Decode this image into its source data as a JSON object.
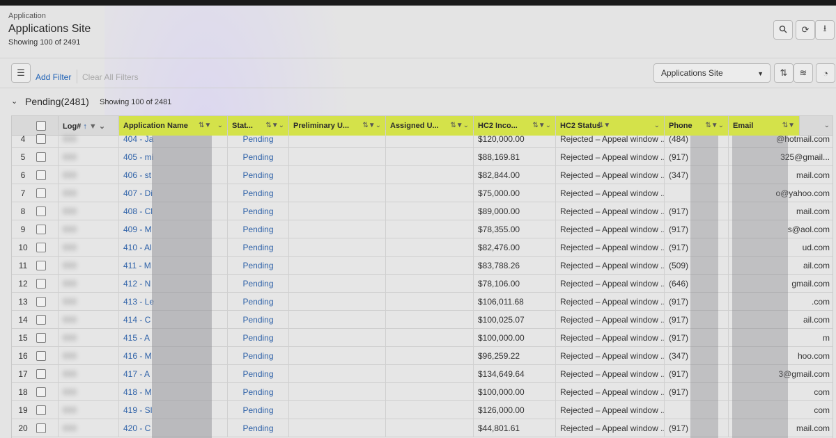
{
  "header": {
    "breadcrumb": "Application",
    "title": "Applications Site",
    "count_text": "Showing 100 of 2491",
    "buttons": [
      "search-icon",
      "refresh-icon",
      "download-icon"
    ]
  },
  "filterbar": {
    "add_filter": "Add Filter",
    "clear_filters": "Clear All Filters",
    "view_selected": "Applications Site"
  },
  "section": {
    "title": "Pending(2481)",
    "count_text": "Showing 100 of 2481"
  },
  "colors": {
    "highlight": "#d4e24a",
    "link": "#2f62a8"
  },
  "columns": [
    {
      "label": "Log#"
    },
    {
      "label": "Application Name"
    },
    {
      "label": "Stat..."
    },
    {
      "label": "Preliminary U..."
    },
    {
      "label": "Assigned U..."
    },
    {
      "label": "HC2 Inco..."
    },
    {
      "label": "HC2 Status"
    },
    {
      "label": "Phone"
    },
    {
      "label": "Email"
    }
  ],
  "rows": [
    {
      "n": "4",
      "name": "404 - Ja",
      "status": "Pending",
      "income": "$120,000.00",
      "hc2": "Rejected – Appeal window ...",
      "phone": "(484)",
      "email": "@hotmail.com"
    },
    {
      "n": "5",
      "name": "405 - mi",
      "status": "Pending",
      "income": "$88,169.81",
      "hc2": "Rejected – Appeal window ...",
      "phone": "(917)",
      "email": "325@gmail..."
    },
    {
      "n": "6",
      "name": "406 - st",
      "status": "Pending",
      "income": "$82,844.00",
      "hc2": "Rejected – Appeal window ...",
      "phone": "(347)",
      "email": "mail.com"
    },
    {
      "n": "7",
      "name": "407 - Di",
      "status": "Pending",
      "income": "$75,000.00",
      "hc2": "Rejected – Appeal window ...",
      "phone": "",
      "email": "o@yahoo.com"
    },
    {
      "n": "8",
      "name": "408 - Cl",
      "status": "Pending",
      "income": "$89,000.00",
      "hc2": "Rejected – Appeal window ...",
      "phone": "(917)",
      "email": "mail.com"
    },
    {
      "n": "9",
      "name": "409 - M",
      "status": "Pending",
      "income": "$78,355.00",
      "hc2": "Rejected – Appeal window ...",
      "phone": "(917)",
      "email": "s@aol.com"
    },
    {
      "n": "10",
      "name": "410 - Al",
      "status": "Pending",
      "income": "$82,476.00",
      "hc2": "Rejected – Appeal window ...",
      "phone": "(917)",
      "email": "ud.com"
    },
    {
      "n": "11",
      "name": "411 - M",
      "status": "Pending",
      "income": "$83,788.26",
      "hc2": "Rejected – Appeal window ...",
      "phone": "(509)",
      "email": "ail.com"
    },
    {
      "n": "12",
      "name": "412 - N",
      "status": "Pending",
      "income": "$78,106.00",
      "hc2": "Rejected – Appeal window ...",
      "phone": "(646)",
      "email": "gmail.com"
    },
    {
      "n": "13",
      "name": "413 - Le",
      "status": "Pending",
      "income": "$106,011.68",
      "hc2": "Rejected – Appeal window ...",
      "phone": "(917)",
      "email": ".com"
    },
    {
      "n": "14",
      "name": "414 - C",
      "status": "Pending",
      "income": "$100,025.07",
      "hc2": "Rejected – Appeal window ...",
      "phone": "(917)",
      "email": "ail.com"
    },
    {
      "n": "15",
      "name": "415 - A",
      "status": "Pending",
      "income": "$100,000.00",
      "hc2": "Rejected – Appeal window ...",
      "phone": "(917)",
      "email": "m"
    },
    {
      "n": "16",
      "name": "416 - M",
      "status": "Pending",
      "income": "$96,259.22",
      "hc2": "Rejected – Appeal window ...",
      "phone": "(347)",
      "email": "hoo.com"
    },
    {
      "n": "17",
      "name": "417 - A",
      "status": "Pending",
      "income": "$134,649.64",
      "hc2": "Rejected – Appeal window ...",
      "phone": "(917)",
      "email": "3@gmail.com"
    },
    {
      "n": "18",
      "name": "418 - M",
      "status": "Pending",
      "income": "$100,000.00",
      "hc2": "Rejected – Appeal window ...",
      "phone": "(917)",
      "email": "com"
    },
    {
      "n": "19",
      "name": "419 - Sl",
      "status": "Pending",
      "income": "$126,000.00",
      "hc2": "Rejected – Appeal window ...",
      "phone": "",
      "email": "com"
    },
    {
      "n": "20",
      "name": "420 - C",
      "status": "Pending",
      "income": "$44,801.61",
      "hc2": "Rejected – Appeal window ...",
      "phone": "(917)",
      "email": "mail.com"
    }
  ]
}
